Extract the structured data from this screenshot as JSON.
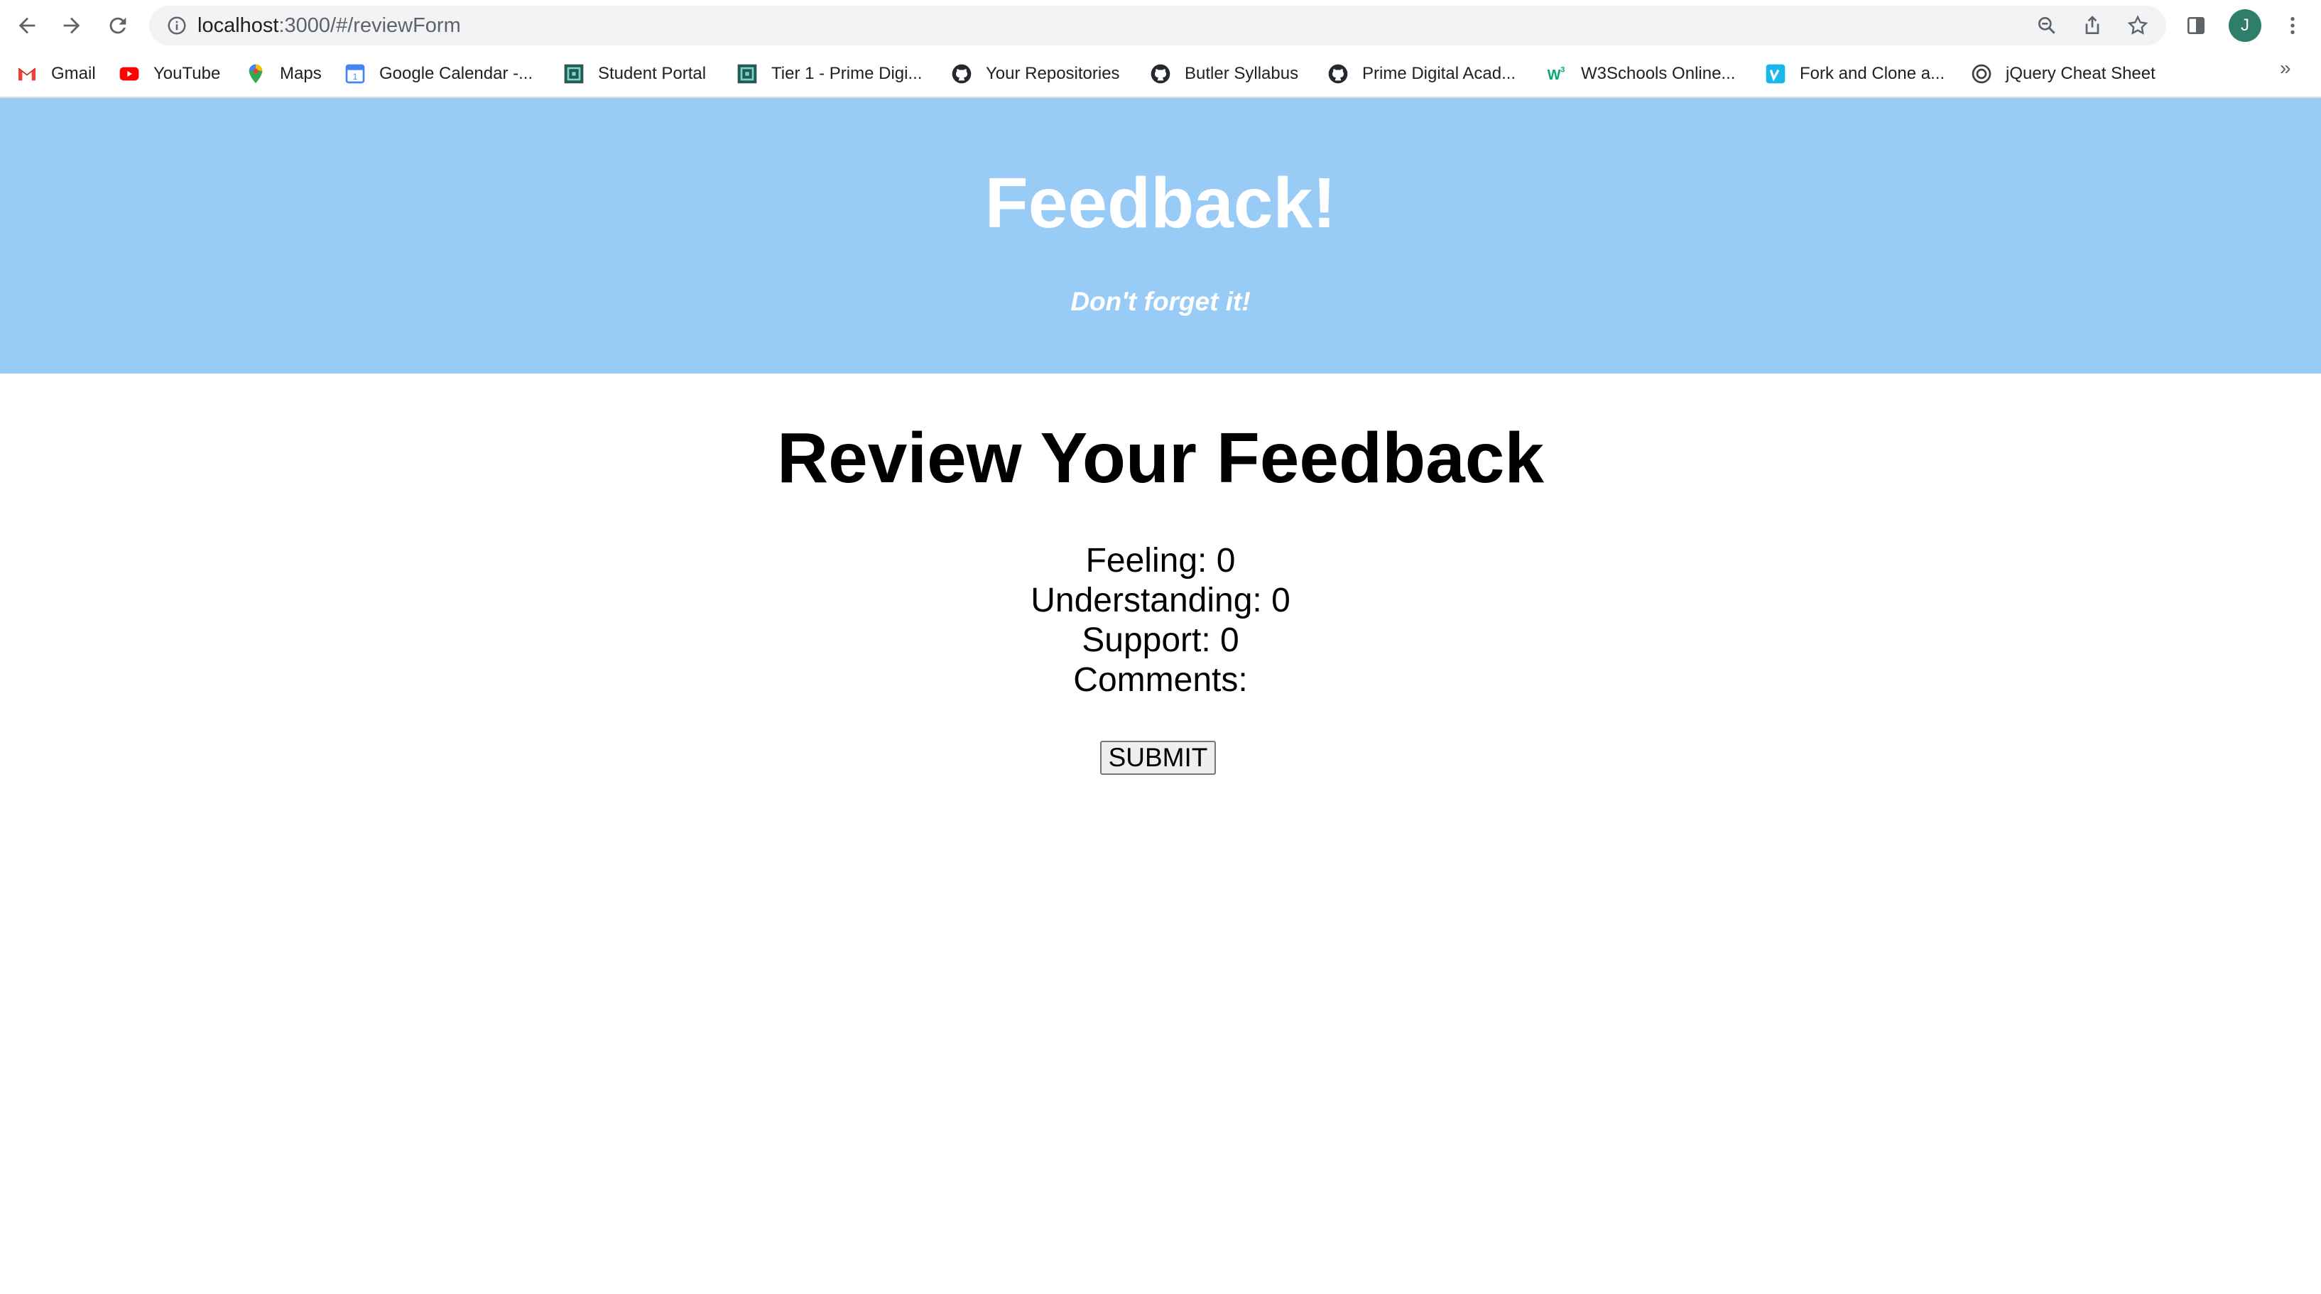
{
  "browser": {
    "url_host": "localhost",
    "url_path": ":3000/#/reviewForm",
    "profile_initial": "J",
    "bookmarks": [
      {
        "label": "Gmail",
        "icon": "gmail-icon"
      },
      {
        "label": "YouTube",
        "icon": "youtube-icon"
      },
      {
        "label": "Maps",
        "icon": "maps-icon"
      },
      {
        "label": "Google Calendar -...",
        "icon": "calendar-icon"
      },
      {
        "label": "Student Portal",
        "icon": "prime-icon"
      },
      {
        "label": "Tier 1 - Prime Digi...",
        "icon": "prime-icon"
      },
      {
        "label": "Your Repositories",
        "icon": "github-icon"
      },
      {
        "label": "Butler Syllabus",
        "icon": "github-icon"
      },
      {
        "label": "Prime Digital Acad...",
        "icon": "github-icon"
      },
      {
        "label": "W3Schools Online...",
        "icon": "w3schools-icon"
      },
      {
        "label": "Fork and Clone a...",
        "icon": "vimeo-icon"
      },
      {
        "label": "jQuery Cheat Sheet",
        "icon": "target-icon"
      }
    ],
    "more_bookmarks": "»"
  },
  "header": {
    "title": "Feedback!",
    "subtitle": "Don't forget it!"
  },
  "review": {
    "heading": "Review Your Feedback",
    "feeling_label": "Feeling: ",
    "feeling_value": "0",
    "understanding_label": "Understanding: ",
    "understanding_value": "0",
    "support_label": "Support: ",
    "support_value": "0",
    "comments_label": "Comments:",
    "comments_value": "",
    "submit_label": "SUBMIT"
  },
  "colors": {
    "hero_background": "#98cbf5",
    "profile_avatar": "#2f7d6b"
  }
}
